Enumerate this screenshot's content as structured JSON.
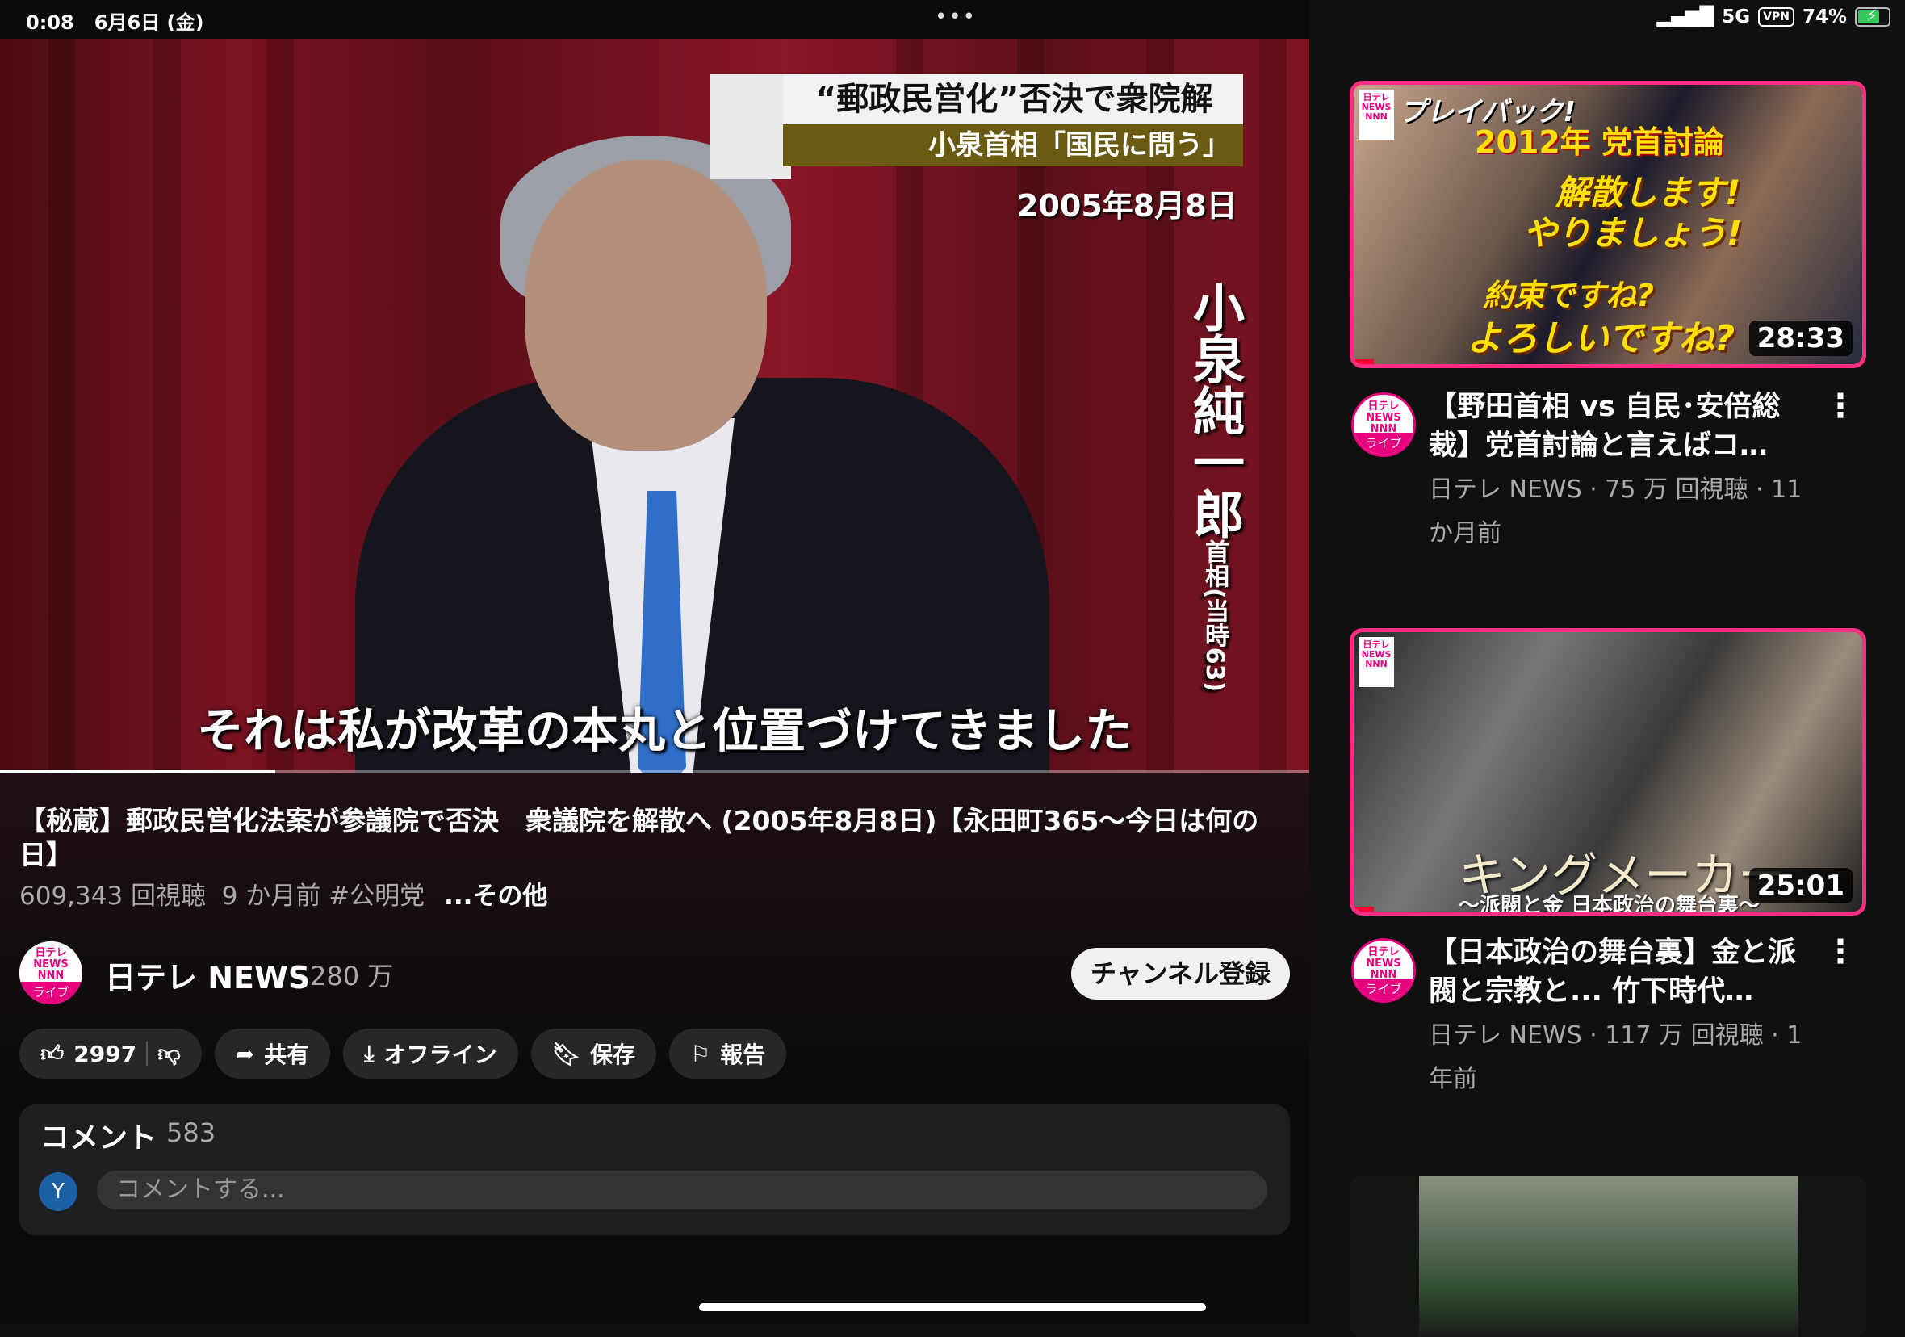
{
  "status_bar": {
    "time": "0:08",
    "date": "6月6日 (金)",
    "dots": "•••",
    "network": "5G",
    "vpn": "VPN",
    "battery": "74%",
    "battery_level": 0.74
  },
  "video": {
    "caption_title": "“郵政民営化”否決で衆院解散",
    "caption_sub": "小泉首相「国民に問う」",
    "caption_date": "2005年8月8日",
    "name_vertical": "小泉純一郎",
    "name_note": "首相(当時63)",
    "subtitle": "それは私が改革の本丸と位置づけてきました",
    "progress": 0.21
  },
  "info": {
    "title": "【秘蔵】郵政民営化法案が参議院で否決　衆議院を解散へ (2005年8月8日)【永田町365～今日は何の日】",
    "views": "609,343 回視聴",
    "age": "9 か月前",
    "hashtag": "#公明党",
    "more": "...その他"
  },
  "channel": {
    "logo_top": "日テレ NEWS NNN",
    "logo_bottom": "ライブ",
    "name": "日テレ NEWS",
    "subs": "280 万",
    "subscribe": "チャンネル登録"
  },
  "actions": {
    "likes": "2997",
    "share": "共有",
    "offline": "オフライン",
    "save": "保存",
    "report": "報告"
  },
  "comments": {
    "title": "コメント",
    "count": "583",
    "avatar": "Y",
    "placeholder": "コメントする..."
  },
  "recommendations": [
    {
      "thumb_h1": "プレイバック!",
      "thumb_h2": "2012年 党首討論",
      "thumb_q1": "解散します!",
      "thumb_q2": "やりましょう!",
      "thumb_q3": "約束ですね?",
      "thumb_q4": "よろしいですね?",
      "duration": "28:33",
      "watched": 0.04,
      "title": "【野田首相 vs 自民･安倍総裁】党首討論と言えばコ…",
      "meta_line1": "日テレ NEWS · 75 万 回視聴 · 11",
      "meta_line2": "か月前"
    },
    {
      "thumb_big": "キングメーカー",
      "thumb_sub": "～派閥と金 日本政治の舞台裏～",
      "duration": "25:01",
      "watched": 0.04,
      "title": "【日本政治の舞台裏】金と派閥と宗教と... 竹下時代…",
      "meta_line1": "日テレ NEWS · 117 万 回視聴 · 1",
      "meta_line2": "年前"
    }
  ],
  "colors": {
    "accent": "#e6007e",
    "thumb_border": "#ff2d83",
    "bg": "#0f0f0f"
  },
  "icons": [
    "thumbs-up-icon",
    "thumbs-down-icon",
    "share-icon",
    "download-icon",
    "bookmark-icon",
    "flag-icon",
    "kebab-icon"
  ]
}
